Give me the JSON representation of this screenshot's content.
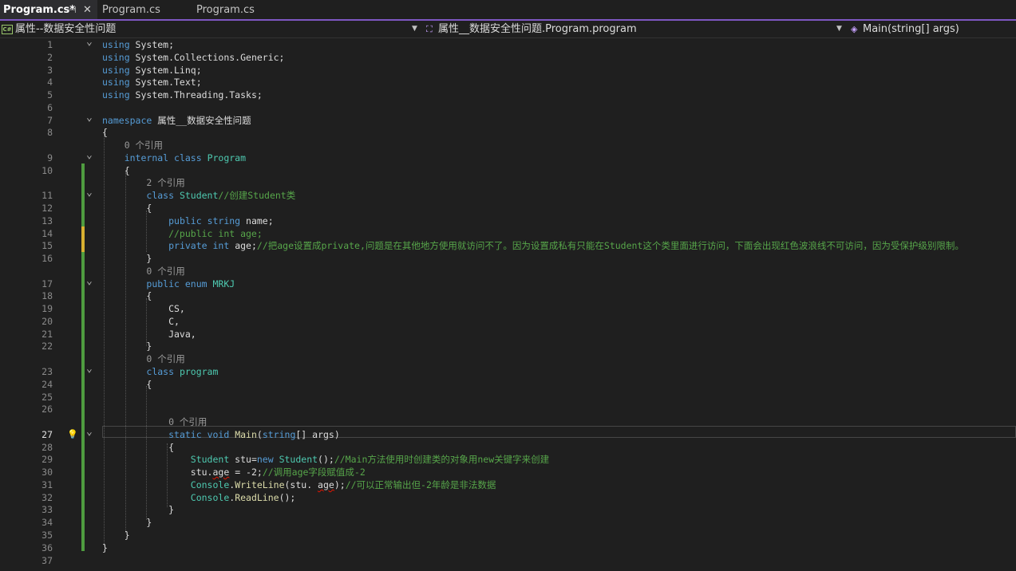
{
  "tabs": [
    {
      "label": "Program.cs*",
      "active": true,
      "pin": "pin-icon",
      "close": "close-icon"
    },
    {
      "label": "Program.cs",
      "active": false
    },
    {
      "label": "Program.cs",
      "active": false
    }
  ],
  "navbar": {
    "project": "属性--数据安全性问题",
    "type_scope": "属性__数据安全性问题.Program.program",
    "member": "Main(string[] args)"
  },
  "current_line": 27,
  "lines": [
    {
      "n": "1",
      "fold": "v",
      "code": [
        {
          "t": "using ",
          "c": "kw"
        },
        {
          "t": "System;",
          "c": ""
        }
      ]
    },
    {
      "n": "2",
      "code": [
        {
          "t": "using ",
          "c": "kw"
        },
        {
          "t": "System.Collections.Generic;",
          "c": ""
        }
      ]
    },
    {
      "n": "3",
      "code": [
        {
          "t": "using ",
          "c": "kw"
        },
        {
          "t": "System.Linq;",
          "c": ""
        }
      ]
    },
    {
      "n": "4",
      "code": [
        {
          "t": "using ",
          "c": "kw"
        },
        {
          "t": "System.Text;",
          "c": ""
        }
      ]
    },
    {
      "n": "5",
      "code": [
        {
          "t": "using ",
          "c": "kw"
        },
        {
          "t": "System.Threading.Tasks;",
          "c": ""
        }
      ]
    },
    {
      "n": "6",
      "code": []
    },
    {
      "n": "7",
      "fold": "v",
      "code": [
        {
          "t": "namespace ",
          "c": "kw"
        },
        {
          "t": "属性__数据安全性问题",
          "c": ""
        }
      ]
    },
    {
      "n": "8",
      "code": [
        {
          "t": "{",
          "c": ""
        }
      ]
    },
    {
      "n": "",
      "code": [
        {
          "t": "    0 个引用",
          "c": "ref"
        }
      ]
    },
    {
      "n": "9",
      "fold": "v",
      "code": [
        {
          "t": "    ",
          "c": ""
        },
        {
          "t": "internal ",
          "c": "kw"
        },
        {
          "t": "class ",
          "c": "kw"
        },
        {
          "t": "Program",
          "c": "ty"
        }
      ]
    },
    {
      "n": "10",
      "code": [
        {
          "t": "    {",
          "c": ""
        }
      ]
    },
    {
      "n": "",
      "code": [
        {
          "t": "        2 个引用",
          "c": "ref"
        }
      ]
    },
    {
      "n": "11",
      "fold": "v",
      "code": [
        {
          "t": "        ",
          "c": ""
        },
        {
          "t": "class ",
          "c": "kw"
        },
        {
          "t": "Student",
          "c": "ty"
        },
        {
          "t": "//创建Student类",
          "c": "cm"
        }
      ]
    },
    {
      "n": "12",
      "code": [
        {
          "t": "        {",
          "c": ""
        }
      ]
    },
    {
      "n": "13",
      "code": [
        {
          "t": "            ",
          "c": ""
        },
        {
          "t": "public ",
          "c": "kw"
        },
        {
          "t": "string ",
          "c": "kw"
        },
        {
          "t": "name;",
          "c": ""
        }
      ]
    },
    {
      "n": "14",
      "code": [
        {
          "t": "            //public int age;",
          "c": "cm"
        }
      ]
    },
    {
      "n": "15",
      "code": [
        {
          "t": "            ",
          "c": ""
        },
        {
          "t": "private ",
          "c": "kw"
        },
        {
          "t": "int ",
          "c": "kw"
        },
        {
          "t": "age;",
          "c": ""
        },
        {
          "t": "//把age设置成private,问题是在其他地方使用就访问不了。因为设置成私有只能在Student这个类里面进行访问，下面会出现红色波浪线不可访问，因为受保护级别限制。",
          "c": "cm"
        }
      ]
    },
    {
      "n": "16",
      "code": [
        {
          "t": "        }",
          "c": ""
        }
      ]
    },
    {
      "n": "",
      "code": [
        {
          "t": "        0 个引用",
          "c": "ref"
        }
      ]
    },
    {
      "n": "17",
      "fold": "v",
      "code": [
        {
          "t": "        ",
          "c": ""
        },
        {
          "t": "public ",
          "c": "kw"
        },
        {
          "t": "enum ",
          "c": "kw"
        },
        {
          "t": "MRKJ",
          "c": "ty"
        }
      ]
    },
    {
      "n": "18",
      "code": [
        {
          "t": "        {",
          "c": ""
        }
      ]
    },
    {
      "n": "19",
      "code": [
        {
          "t": "            CS,",
          "c": ""
        }
      ]
    },
    {
      "n": "20",
      "code": [
        {
          "t": "            C,",
          "c": ""
        }
      ]
    },
    {
      "n": "21",
      "code": [
        {
          "t": "            Java,",
          "c": ""
        }
      ]
    },
    {
      "n": "22",
      "code": [
        {
          "t": "        }",
          "c": ""
        }
      ]
    },
    {
      "n": "",
      "code": [
        {
          "t": "        0 个引用",
          "c": "ref"
        }
      ]
    },
    {
      "n": "23",
      "fold": "v",
      "code": [
        {
          "t": "        ",
          "c": ""
        },
        {
          "t": "class ",
          "c": "kw"
        },
        {
          "t": "program",
          "c": "ty"
        }
      ]
    },
    {
      "n": "24",
      "code": [
        {
          "t": "        {",
          "c": ""
        }
      ]
    },
    {
      "n": "25",
      "code": []
    },
    {
      "n": "26",
      "code": []
    },
    {
      "n": "",
      "code": [
        {
          "t": "            0 个引用",
          "c": "ref"
        }
      ]
    },
    {
      "n": "27",
      "fold": "v",
      "lens": true,
      "code": [
        {
          "t": "            ",
          "c": ""
        },
        {
          "t": "static ",
          "c": "kw"
        },
        {
          "t": "void ",
          "c": "kw"
        },
        {
          "t": "Main",
          "c": "fn"
        },
        {
          "t": "(",
          "c": ""
        },
        {
          "t": "string",
          "c": "kw"
        },
        {
          "t": "[] args)",
          "c": ""
        }
      ]
    },
    {
      "n": "28",
      "code": [
        {
          "t": "            {",
          "c": ""
        }
      ]
    },
    {
      "n": "29",
      "code": [
        {
          "t": "                ",
          "c": ""
        },
        {
          "t": "Student ",
          "c": "ty"
        },
        {
          "t": "stu=",
          "c": ""
        },
        {
          "t": "new ",
          "c": "kw"
        },
        {
          "t": "Student",
          "c": "ty"
        },
        {
          "t": "();",
          "c": ""
        },
        {
          "t": "//Main方法使用时创建类的对象用new关键字来创建",
          "c": "cm"
        }
      ]
    },
    {
      "n": "30",
      "code": [
        {
          "t": "                stu.",
          "c": ""
        },
        {
          "t": "age",
          "c": "squig"
        },
        {
          "t": " = -2;",
          "c": ""
        },
        {
          "t": "//调用age字段赋值成-2",
          "c": "cm"
        }
      ]
    },
    {
      "n": "31",
      "code": [
        {
          "t": "                ",
          "c": ""
        },
        {
          "t": "Console",
          "c": "ty"
        },
        {
          "t": ".",
          "c": ""
        },
        {
          "t": "WriteLine",
          "c": "fn"
        },
        {
          "t": "(stu. ",
          "c": ""
        },
        {
          "t": "age",
          "c": "squig"
        },
        {
          "t": ");",
          "c": ""
        },
        {
          "t": "//可以正常输出但-2年龄是非法数据",
          "c": "cm"
        }
      ]
    },
    {
      "n": "32",
      "code": [
        {
          "t": "                ",
          "c": ""
        },
        {
          "t": "Console",
          "c": "ty"
        },
        {
          "t": ".",
          "c": ""
        },
        {
          "t": "ReadLine",
          "c": "fn"
        },
        {
          "t": "();",
          "c": ""
        }
      ]
    },
    {
      "n": "33",
      "code": [
        {
          "t": "            }",
          "c": ""
        }
      ]
    },
    {
      "n": "34",
      "code": [
        {
          "t": "        }",
          "c": ""
        }
      ]
    },
    {
      "n": "35",
      "code": [
        {
          "t": "    }",
          "c": ""
        }
      ]
    },
    {
      "n": "36",
      "code": [
        {
          "t": "}",
          "c": ""
        }
      ]
    },
    {
      "n": "37",
      "code": []
    }
  ]
}
